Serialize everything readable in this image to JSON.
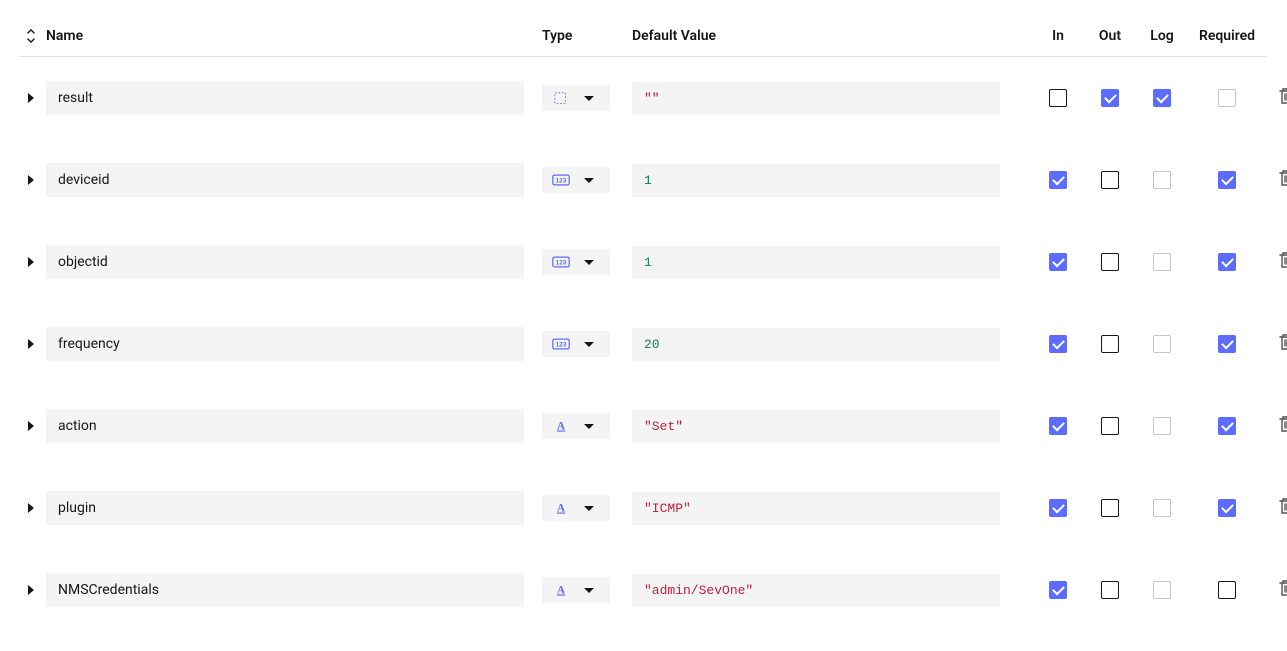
{
  "headers": {
    "name": "Name",
    "type": "Type",
    "default": "Default Value",
    "in": "In",
    "out": "Out",
    "log": "Log",
    "required": "Required"
  },
  "rows": [
    {
      "name": "result",
      "type": "any",
      "default": "\"\"",
      "valueKind": "string",
      "in": false,
      "out": true,
      "log": true,
      "required": false,
      "requiredDisabled": true
    },
    {
      "name": "deviceid",
      "type": "number",
      "default": "1",
      "valueKind": "number",
      "in": true,
      "out": false,
      "log": false,
      "logDisabled": true,
      "required": true
    },
    {
      "name": "objectid",
      "type": "number",
      "default": "1",
      "valueKind": "number",
      "in": true,
      "out": false,
      "log": false,
      "logDisabled": true,
      "required": true
    },
    {
      "name": "frequency",
      "type": "number",
      "default": "20",
      "valueKind": "number",
      "in": true,
      "out": false,
      "log": false,
      "logDisabled": true,
      "required": true
    },
    {
      "name": "action",
      "type": "string",
      "default": "\"Set\"",
      "valueKind": "string",
      "in": true,
      "out": false,
      "log": false,
      "logDisabled": true,
      "required": true
    },
    {
      "name": "plugin",
      "type": "string",
      "default": "\"ICMP\"",
      "valueKind": "string",
      "in": true,
      "out": false,
      "log": false,
      "logDisabled": true,
      "required": true
    },
    {
      "name": "NMSCredentials",
      "type": "string",
      "default": "\"admin/SevOne\"",
      "valueKind": "string",
      "in": true,
      "out": false,
      "log": false,
      "logDisabled": true,
      "required": false
    }
  ]
}
